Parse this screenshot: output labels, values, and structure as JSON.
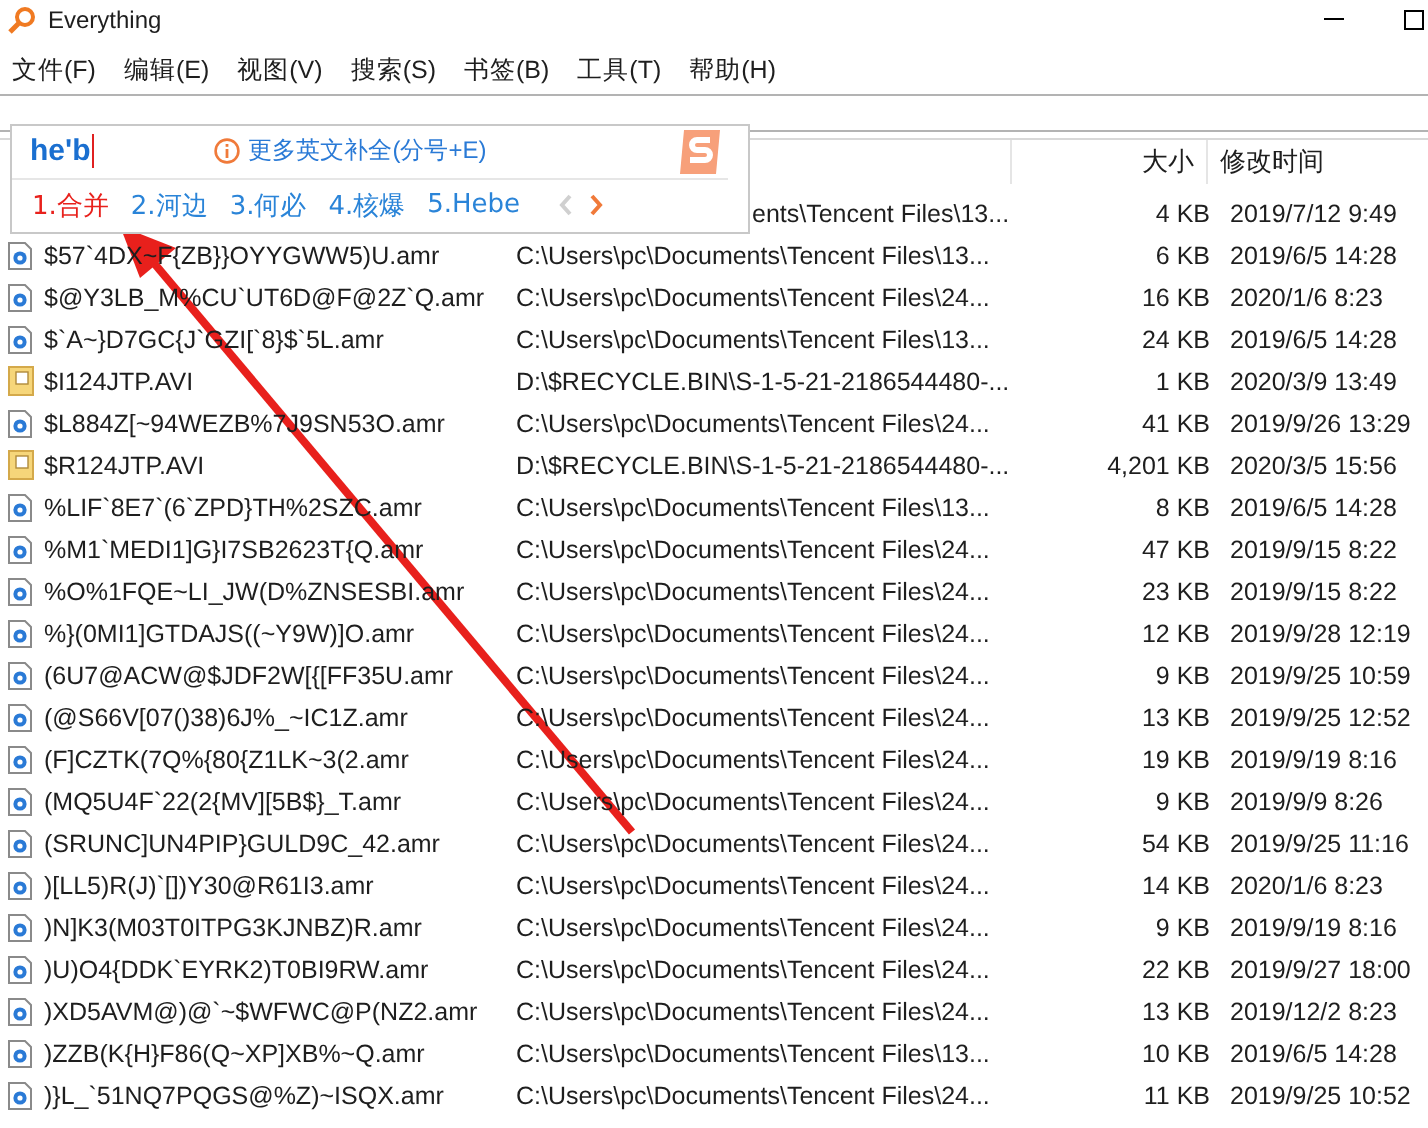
{
  "window": {
    "title": "Everything"
  },
  "menu": [
    "文件(F)",
    "编辑(E)",
    "视图(V)",
    "搜索(S)",
    "书签(B)",
    "工具(T)",
    "帮助(H)"
  ],
  "columns": {
    "size": "大小",
    "modified": "修改时间"
  },
  "rows": [
    {
      "path": "ents\\Tencent Files\\13...",
      "size": "4 KB",
      "modified": "2019/7/12 9:49"
    },
    {
      "kind": "audio",
      "name": "$57`4DX~F{ZB}}OYYGWW5)U.amr",
      "path": "C:\\Users\\pc\\Documents\\Tencent Files\\13...",
      "size": "6 KB",
      "modified": "2019/6/5 14:28"
    },
    {
      "kind": "audio",
      "name": "$@Y3LB_M%CU`UT6D@F@2Z`Q.amr",
      "path": "C:\\Users\\pc\\Documents\\Tencent Files\\24...",
      "size": "16 KB",
      "modified": "2020/1/6 8:23"
    },
    {
      "kind": "audio",
      "name": "$`A~}D7GC{J`GZI[`8}$`5L.amr",
      "path": "C:\\Users\\pc\\Documents\\Tencent Files\\13...",
      "size": "24 KB",
      "modified": "2019/6/5 14:28"
    },
    {
      "kind": "video",
      "name": "$I124JTP.AVI",
      "path": "D:\\$RECYCLE.BIN\\S-1-5-21-2186544480-...",
      "size": "1 KB",
      "modified": "2020/3/9 13:49"
    },
    {
      "kind": "audio",
      "name": "$L884Z[~94WEZB%7J9SN53O.amr",
      "path": "C:\\Users\\pc\\Documents\\Tencent Files\\24...",
      "size": "41 KB",
      "modified": "2019/9/26 13:29"
    },
    {
      "kind": "video",
      "name": "$R124JTP.AVI",
      "path": "D:\\$RECYCLE.BIN\\S-1-5-21-2186544480-...",
      "size": "4,201 KB",
      "modified": "2020/3/5 15:56"
    },
    {
      "kind": "audio",
      "name": "%LIF`8E7`(6`ZPD}TH%2SZC.amr",
      "path": "C:\\Users\\pc\\Documents\\Tencent Files\\13...",
      "size": "8 KB",
      "modified": "2019/6/5 14:28"
    },
    {
      "kind": "audio",
      "name": "%M1`MEDI1]G}I7SB2623T{Q.amr",
      "path": "C:\\Users\\pc\\Documents\\Tencent Files\\24...",
      "size": "47 KB",
      "modified": "2019/9/15 8:22"
    },
    {
      "kind": "audio",
      "name": "%O%1FQE~LI_JW(D%ZNSESBI.amr",
      "path": "C:\\Users\\pc\\Documents\\Tencent Files\\24...",
      "size": "23 KB",
      "modified": "2019/9/15 8:22"
    },
    {
      "kind": "audio",
      "name": "%}(0MI1]GTDAJS((~Y9W)]O.amr",
      "path": "C:\\Users\\pc\\Documents\\Tencent Files\\24...",
      "size": "12 KB",
      "modified": "2019/9/28 12:19"
    },
    {
      "kind": "audio",
      "name": "(6U7@ACW@$JDF2W[{[FF35U.amr",
      "path": "C:\\Users\\pc\\Documents\\Tencent Files\\24...",
      "size": "9 KB",
      "modified": "2019/9/25 10:59"
    },
    {
      "kind": "audio",
      "name": "(@S66V[07()38)6J%_~IC1Z.amr",
      "path": "C:\\Users\\pc\\Documents\\Tencent Files\\24...",
      "size": "13 KB",
      "modified": "2019/9/25 12:52"
    },
    {
      "kind": "audio",
      "name": "(F]CZTK(7Q%{80{Z1LK~3(2.amr",
      "path": "C:\\Users\\pc\\Documents\\Tencent Files\\24...",
      "size": "19 KB",
      "modified": "2019/9/19 8:16"
    },
    {
      "kind": "audio",
      "name": "(MQ5U4F`22(2{MV][5B$}_T.amr",
      "path": "C:\\Users\\pc\\Documents\\Tencent Files\\24...",
      "size": "9 KB",
      "modified": "2019/9/9 8:26"
    },
    {
      "kind": "audio",
      "name": "(SRUNC]UN4PIP}GULD9C_42.amr",
      "path": "C:\\Users\\pc\\Documents\\Tencent Files\\24...",
      "size": "54 KB",
      "modified": "2019/9/25 11:16"
    },
    {
      "kind": "audio",
      "name": ")[LL5)R(J)`[])Y30@R61I3.amr",
      "path": "C:\\Users\\pc\\Documents\\Tencent Files\\24...",
      "size": "14 KB",
      "modified": "2020/1/6 8:23"
    },
    {
      "kind": "audio",
      "name": ")N]K3(M03T0ITPG3KJNBZ)R.amr",
      "path": "C:\\Users\\pc\\Documents\\Tencent Files\\24...",
      "size": "9 KB",
      "modified": "2019/9/19 8:16"
    },
    {
      "kind": "audio",
      "name": ")U)O4{DDK`EYRK2)T0BI9RW.amr",
      "path": "C:\\Users\\pc\\Documents\\Tencent Files\\24...",
      "size": "22 KB",
      "modified": "2019/9/27 18:00"
    },
    {
      "kind": "audio",
      "name": ")XD5AVM@)@`~$WFWC@P(NZ2.amr",
      "path": "C:\\Users\\pc\\Documents\\Tencent Files\\24...",
      "size": "13 KB",
      "modified": "2019/12/2 8:23"
    },
    {
      "kind": "audio",
      "name": ")ZZB(K{H}F86(Q~XP]XB%~Q.amr",
      "path": "C:\\Users\\pc\\Documents\\Tencent Files\\13...",
      "size": "10 KB",
      "modified": "2019/6/5 14:28"
    },
    {
      "kind": "audio",
      "name": ")}L_`51NQ7PQGS@%Z)~ISQX.amr",
      "path": "C:\\Users\\pc\\Documents\\Tencent Files\\24...",
      "size": "11 KB",
      "modified": "2019/9/25 10:52"
    }
  ],
  "ime": {
    "composition": "he'b",
    "hint": "更多英文补全(分号+E)",
    "candidates": [
      {
        "label": "1.合并",
        "selected": true
      },
      {
        "label": "2.河边",
        "selected": false
      },
      {
        "label": "3.何必",
        "selected": false
      },
      {
        "label": "4.核爆",
        "selected": false
      },
      {
        "label": "5.Hebe",
        "selected": false
      }
    ],
    "prev_disabled": true,
    "next_disabled": false
  }
}
